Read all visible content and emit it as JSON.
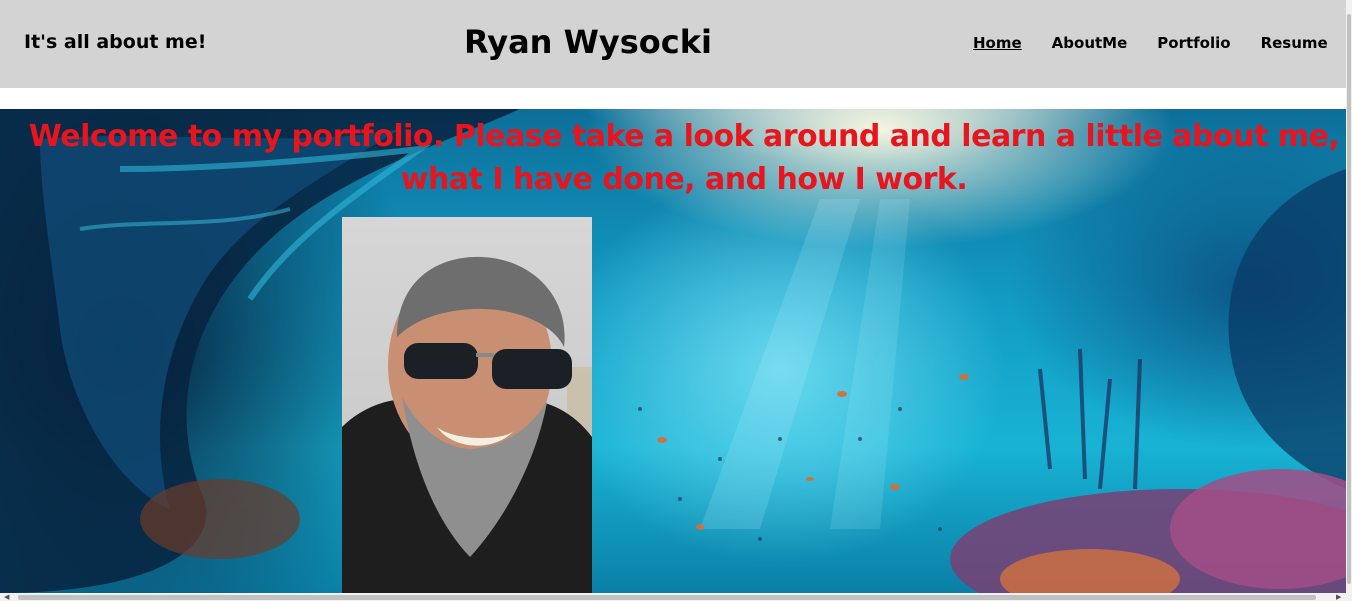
{
  "header": {
    "tagline": "It's all about me!",
    "title": "Ryan Wysocki",
    "nav": [
      {
        "label": "Home",
        "active": true
      },
      {
        "label": "AboutMe",
        "active": false
      },
      {
        "label": "Portfolio",
        "active": false
      },
      {
        "label": "Resume",
        "active": false
      }
    ]
  },
  "hero": {
    "welcome": "Welcome to my portfolio. Please take a look around and learn a little about me, what I have done, and how I work."
  },
  "colors": {
    "header_bg": "#d3d3d3",
    "welcome_text": "#e8141e"
  }
}
